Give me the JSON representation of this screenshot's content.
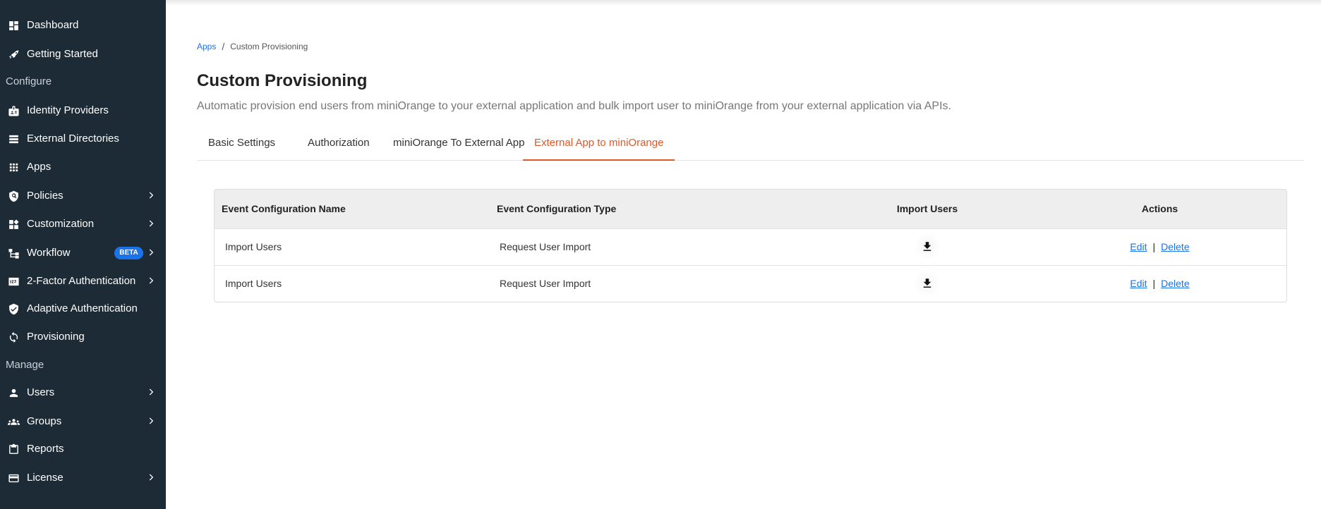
{
  "sidebar": {
    "items": [
      {
        "label": "Dashboard",
        "icon": "dashboard-icon"
      },
      {
        "label": "Getting Started",
        "icon": "rocket-icon"
      },
      {
        "label": "Identity Providers",
        "icon": "id-badge-icon"
      },
      {
        "label": "External Directories",
        "icon": "list-icon"
      },
      {
        "label": "Apps",
        "icon": "grid-icon"
      },
      {
        "label": "Policies",
        "icon": "policy-icon"
      },
      {
        "label": "Customization",
        "icon": "customization-icon"
      },
      {
        "label": "Workflow",
        "icon": "workflow-icon",
        "badge": "BETA"
      },
      {
        "label": "2-Factor Authentication",
        "icon": "123-icon"
      },
      {
        "label": "Adaptive Authentication",
        "icon": "shield-check-icon"
      },
      {
        "label": "Provisioning",
        "icon": "sync-icon"
      },
      {
        "label": "Users",
        "icon": "user-icon"
      },
      {
        "label": "Groups",
        "icon": "groups-icon"
      },
      {
        "label": "Reports",
        "icon": "clipboard-icon"
      },
      {
        "label": "License",
        "icon": "card-icon"
      }
    ],
    "sections": {
      "configure": "Configure",
      "manage": "Manage"
    }
  },
  "breadcrumb": {
    "parent": "Apps",
    "separator": "/",
    "current": "Custom Provisioning"
  },
  "page": {
    "title": "Custom Provisioning",
    "subtitle": "Automatic provision end users from miniOrange to your external application and bulk import user to miniOrange from your external application via APIs."
  },
  "tabs": [
    {
      "label": "Basic Settings",
      "active": false
    },
    {
      "label": "Authorization",
      "active": false
    },
    {
      "label": "miniOrange To External App",
      "active": false
    },
    {
      "label": "External App to miniOrange",
      "active": true
    }
  ],
  "table": {
    "headers": [
      "Event Configuration Name",
      "Event Configuration Type",
      "Import Users",
      "Actions"
    ],
    "rows": [
      {
        "name": "Import Users",
        "type": "Request User Import",
        "edit": "Edit",
        "sep": "|",
        "delete": "Delete"
      },
      {
        "name": "Import Users",
        "type": "Request User Import",
        "edit": "Edit",
        "sep": "|",
        "delete": "Delete"
      }
    ]
  },
  "colors": {
    "sidebar_bg": "#1d2b36",
    "accent": "#e0582a",
    "link": "#1a73e8",
    "badge": "#1a73e8"
  }
}
